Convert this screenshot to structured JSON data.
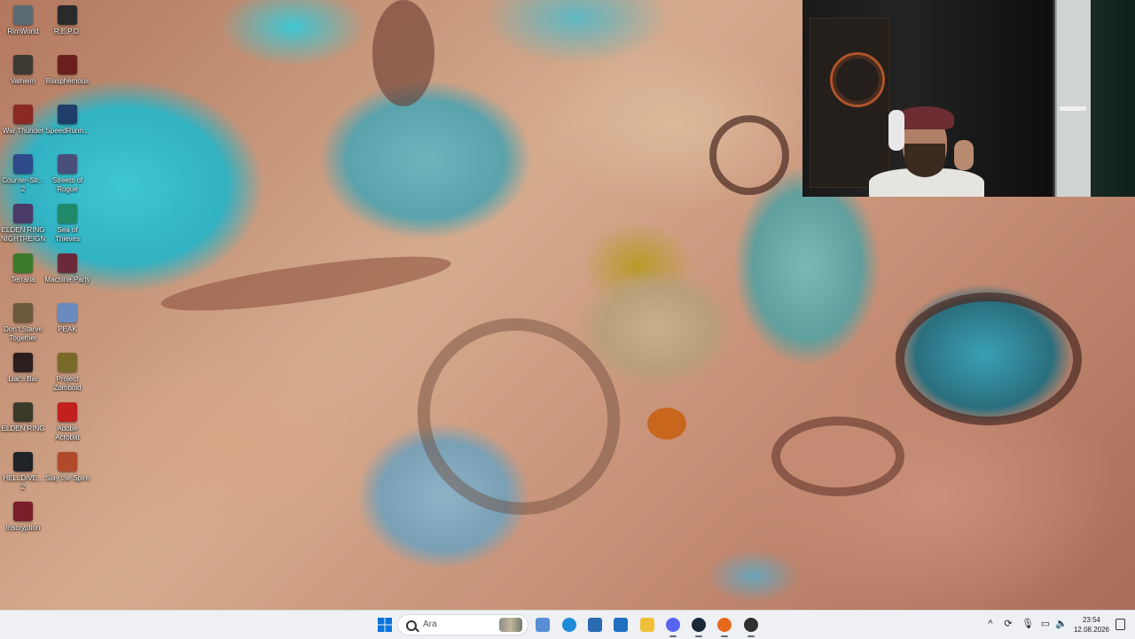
{
  "desktop": {
    "icons": [
      {
        "label": "RimWorld",
        "icon": "rimworld-icon",
        "color": "#5b6b74"
      },
      {
        "label": "R.E.P.O.",
        "icon": "repo-icon",
        "color": "#2a2a2a"
      },
      {
        "label": "Valheim",
        "icon": "valheim-icon",
        "color": "#3d3a33"
      },
      {
        "label": "Blasphemous",
        "icon": "blasphemous-icon",
        "color": "#6b1e1e"
      },
      {
        "label": "War Thunder",
        "icon": "war-thunder-icon",
        "color": "#8a2a22"
      },
      {
        "label": "SpeedRunn...",
        "icon": "speedrunners-icon",
        "color": "#1f3f6a"
      },
      {
        "label": "Counter-Str... 2",
        "icon": "counter-strike-icon",
        "color": "#2e4a8a"
      },
      {
        "label": "Streets of Rogue",
        "icon": "streets-of-rogue-icon",
        "color": "#4a4f7a"
      },
      {
        "label": "ELDEN RING NIGHTREIGN",
        "icon": "elden-ring-nightreign-icon",
        "color": "#4a3a6a"
      },
      {
        "label": "Sea of Thieves",
        "icon": "sea-of-thieves-icon",
        "color": "#1f8a6a"
      },
      {
        "label": "Terraria",
        "icon": "terraria-icon",
        "color": "#3a7a2a"
      },
      {
        "label": "Machine Party",
        "icon": "machine-party-icon",
        "color": "#6a2a3a"
      },
      {
        "label": "Don't Starve Together",
        "icon": "dont-starve-together-icon",
        "color": "#6a5a3a"
      },
      {
        "label": "PEAK",
        "icon": "peak-icon",
        "color": "#6a8ac0"
      },
      {
        "label": "Liar's Bar",
        "icon": "liars-bar-icon",
        "color": "#2a1e1e"
      },
      {
        "label": "Project Zomboid",
        "icon": "project-zomboid-icon",
        "color": "#7a6a2a"
      },
      {
        "label": "ELDEN RING",
        "icon": "elden-ring-icon",
        "color": "#3a3a2a"
      },
      {
        "label": "Adobe Acrobat",
        "icon": "adobe-acrobat-icon",
        "color": "#c0201e"
      },
      {
        "label": "HELLDIVE... 2",
        "icon": "helldivers-icon",
        "color": "#202428"
      },
      {
        "label": "Slay the Spire",
        "icon": "slay-the-spire-icon",
        "color": "#b04a2a"
      },
      {
        "label": "Inscryption",
        "icon": "inscryption-icon",
        "color": "#7a1e2a"
      }
    ]
  },
  "taskbar": {
    "start_icon": "windows-start-icon",
    "search": {
      "placeholder": "Ara"
    },
    "apps": [
      {
        "name": "task-view-icon",
        "color": "#5a8fd6"
      },
      {
        "name": "edge-icon",
        "color": "#1e8ad8"
      },
      {
        "name": "microsoft-store-icon",
        "color": "#2a6ab0"
      },
      {
        "name": "outlook-icon",
        "color": "#1f6fc0"
      },
      {
        "name": "file-explorer-icon",
        "color": "#f0c038"
      },
      {
        "name": "discord-icon",
        "color": "#5865f2"
      },
      {
        "name": "steam-icon",
        "color": "#1b2838"
      },
      {
        "name": "firefox-icon",
        "color": "#e66a1e"
      },
      {
        "name": "obs-icon",
        "color": "#303030"
      }
    ],
    "tray": {
      "chevron": "^",
      "clock_time": "23:54",
      "clock_date": "12.08.2026"
    }
  }
}
